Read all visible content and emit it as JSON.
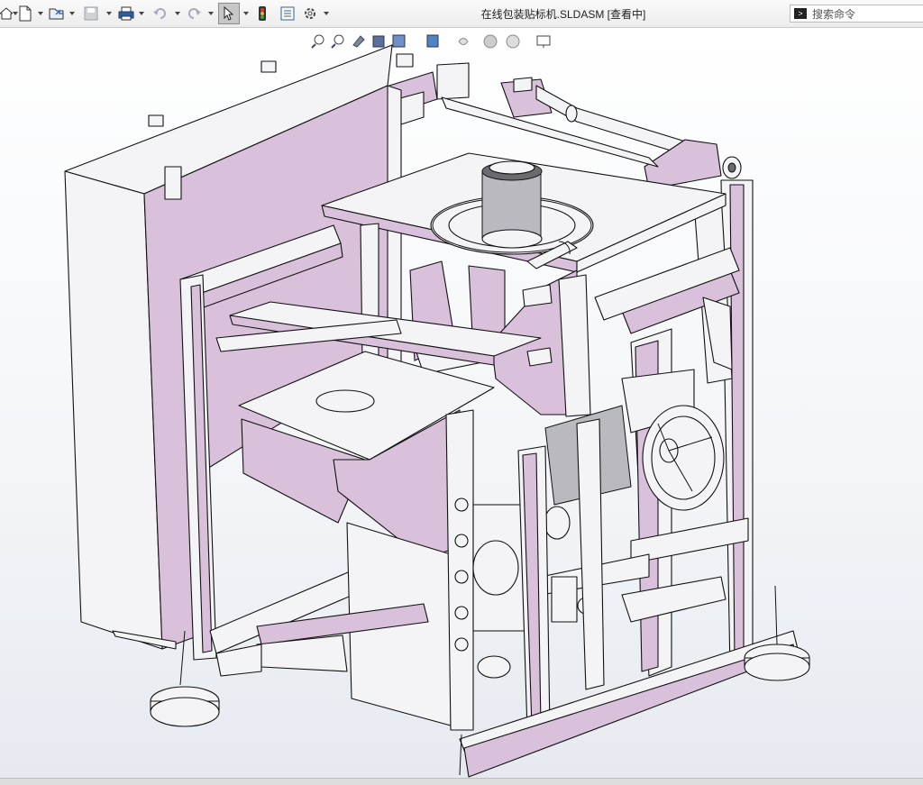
{
  "window": {
    "title": "在线包装贴标机.SLDASM [查看中]"
  },
  "search": {
    "placeholder": "搜索命令"
  },
  "toolbar": {
    "items": [
      "home-icon",
      "new-document-icon",
      "open-folder-icon",
      "save-icon",
      "print-icon",
      "undo-icon",
      "redo-icon",
      "select-pointer-icon",
      "traffic-light-icon",
      "options-list-icon",
      "gear-icon"
    ]
  },
  "heads_up_toolbar": {
    "items": [
      "zoom-to-fit-icon",
      "zoom-to-area-icon",
      "previous-view-icon",
      "section-view-icon",
      "view-orientation-icon",
      "display-style-icon",
      "hide-show-icon",
      "edit-appearance-icon",
      "apply-scene-icon",
      "view-settings-icon"
    ]
  },
  "model": {
    "name": "在线包装贴标机",
    "colors": {
      "plate": "#d9c1db",
      "frame": "#f4f4f6",
      "line": "#1a1a1a"
    }
  }
}
